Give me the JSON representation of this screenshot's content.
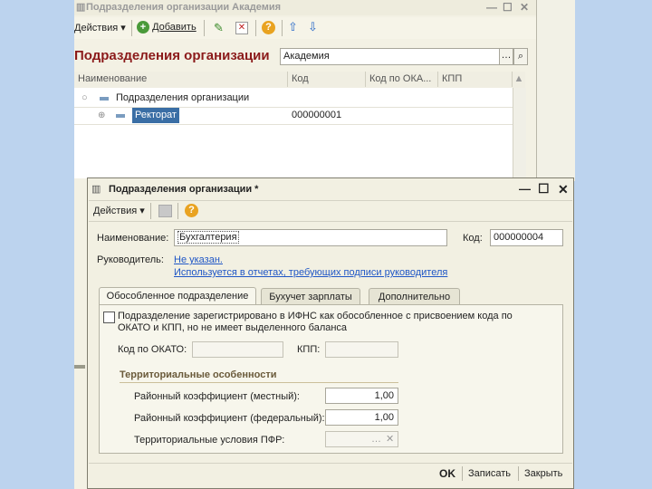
{
  "back_window": {
    "title": "Подразделения организации Академия",
    "toolbar": {
      "actions": "Действия",
      "add": "Добавить"
    },
    "heading": "Подразделения организации",
    "filter_value": "Академия",
    "columns": [
      "Наименование",
      "Код",
      "Код по ОКА...",
      "КПП"
    ],
    "rows": [
      {
        "name": "Подразделения организации",
        "code": ""
      },
      {
        "name": "Ректорат",
        "code": "000000001"
      }
    ]
  },
  "dialog": {
    "title": "Подразделения организации *",
    "toolbar": {
      "actions": "Действия"
    },
    "name_label": "Наименование:",
    "name_value": "Бухгалтерия",
    "code_label": "Код:",
    "code_value": "000000004",
    "head_label": "Руководитель:",
    "head_link": "Не указан.",
    "head_note": "Используется в отчетах, требующих подписи руководителя",
    "tabs": [
      "Обособленное подразделение",
      "Бухучет зарплаты",
      "Дополнительно"
    ],
    "registered_text": "Подразделение зарегистрировано в ИФНС как обособленное с присвоением кода по ОКАТО и КПП, но не имеет выделенного баланса",
    "registered_checked": false,
    "okato_label": "Код по ОКАТО:",
    "kpp_label": "КПП:",
    "territorial_title": "Территориальные особенности",
    "coef_local_label": "Районный коэффициент (местный):",
    "coef_local_value": "1,00",
    "coef_fed_label": "Районный коэффициент (федеральный):",
    "coef_fed_value": "1,00",
    "pfr_label": "Территориальные условия ПФР:",
    "buttons": {
      "ok": "OK",
      "save": "Записать",
      "close": "Закрыть"
    }
  },
  "colors": {
    "heading_red": "#8b1a1a",
    "link_blue": "#1f56c6",
    "selection": "#3a6ea5",
    "background": "#bcd3ee"
  },
  "icons": [
    "edit-icon",
    "delete-icon",
    "help-icon",
    "arrow-up-icon",
    "arrow-down-icon",
    "search-icon",
    "add-icon",
    "save-list-icon"
  ]
}
